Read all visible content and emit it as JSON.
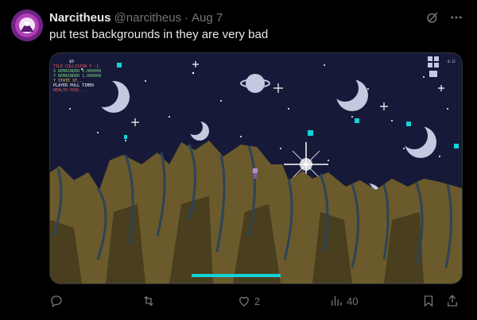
{
  "tweet": {
    "display_name": "Narcitheus",
    "handle": "@narcitheus",
    "separator": "·",
    "date": "Aug 7",
    "text": "put test backgrounds in they are very bad"
  },
  "header_icons": [
    "grok-icon",
    "more-icon"
  ],
  "media": {
    "hud_lines": [
      "$5",
      "TILE COLLISION Y -1",
      "X REMAINDER 0.000000",
      "Y REMAINDER 1.000000",
      "Y STATE ST...",
      "PLAYER PULL TIMER",
      "HEALTH POOL ..."
    ],
    "corner_label": "0:12",
    "colors": {
      "sky": "#171937",
      "terrain": "#6b5a2c",
      "terrain_dark": "#3a3218",
      "vine": "#2d4458",
      "accent_cyan": "#13d3d8",
      "moon": "#c5c9e0"
    }
  },
  "actions": {
    "reply_count": "",
    "retweet_count": "",
    "like_count": "2",
    "views_count": "40"
  }
}
